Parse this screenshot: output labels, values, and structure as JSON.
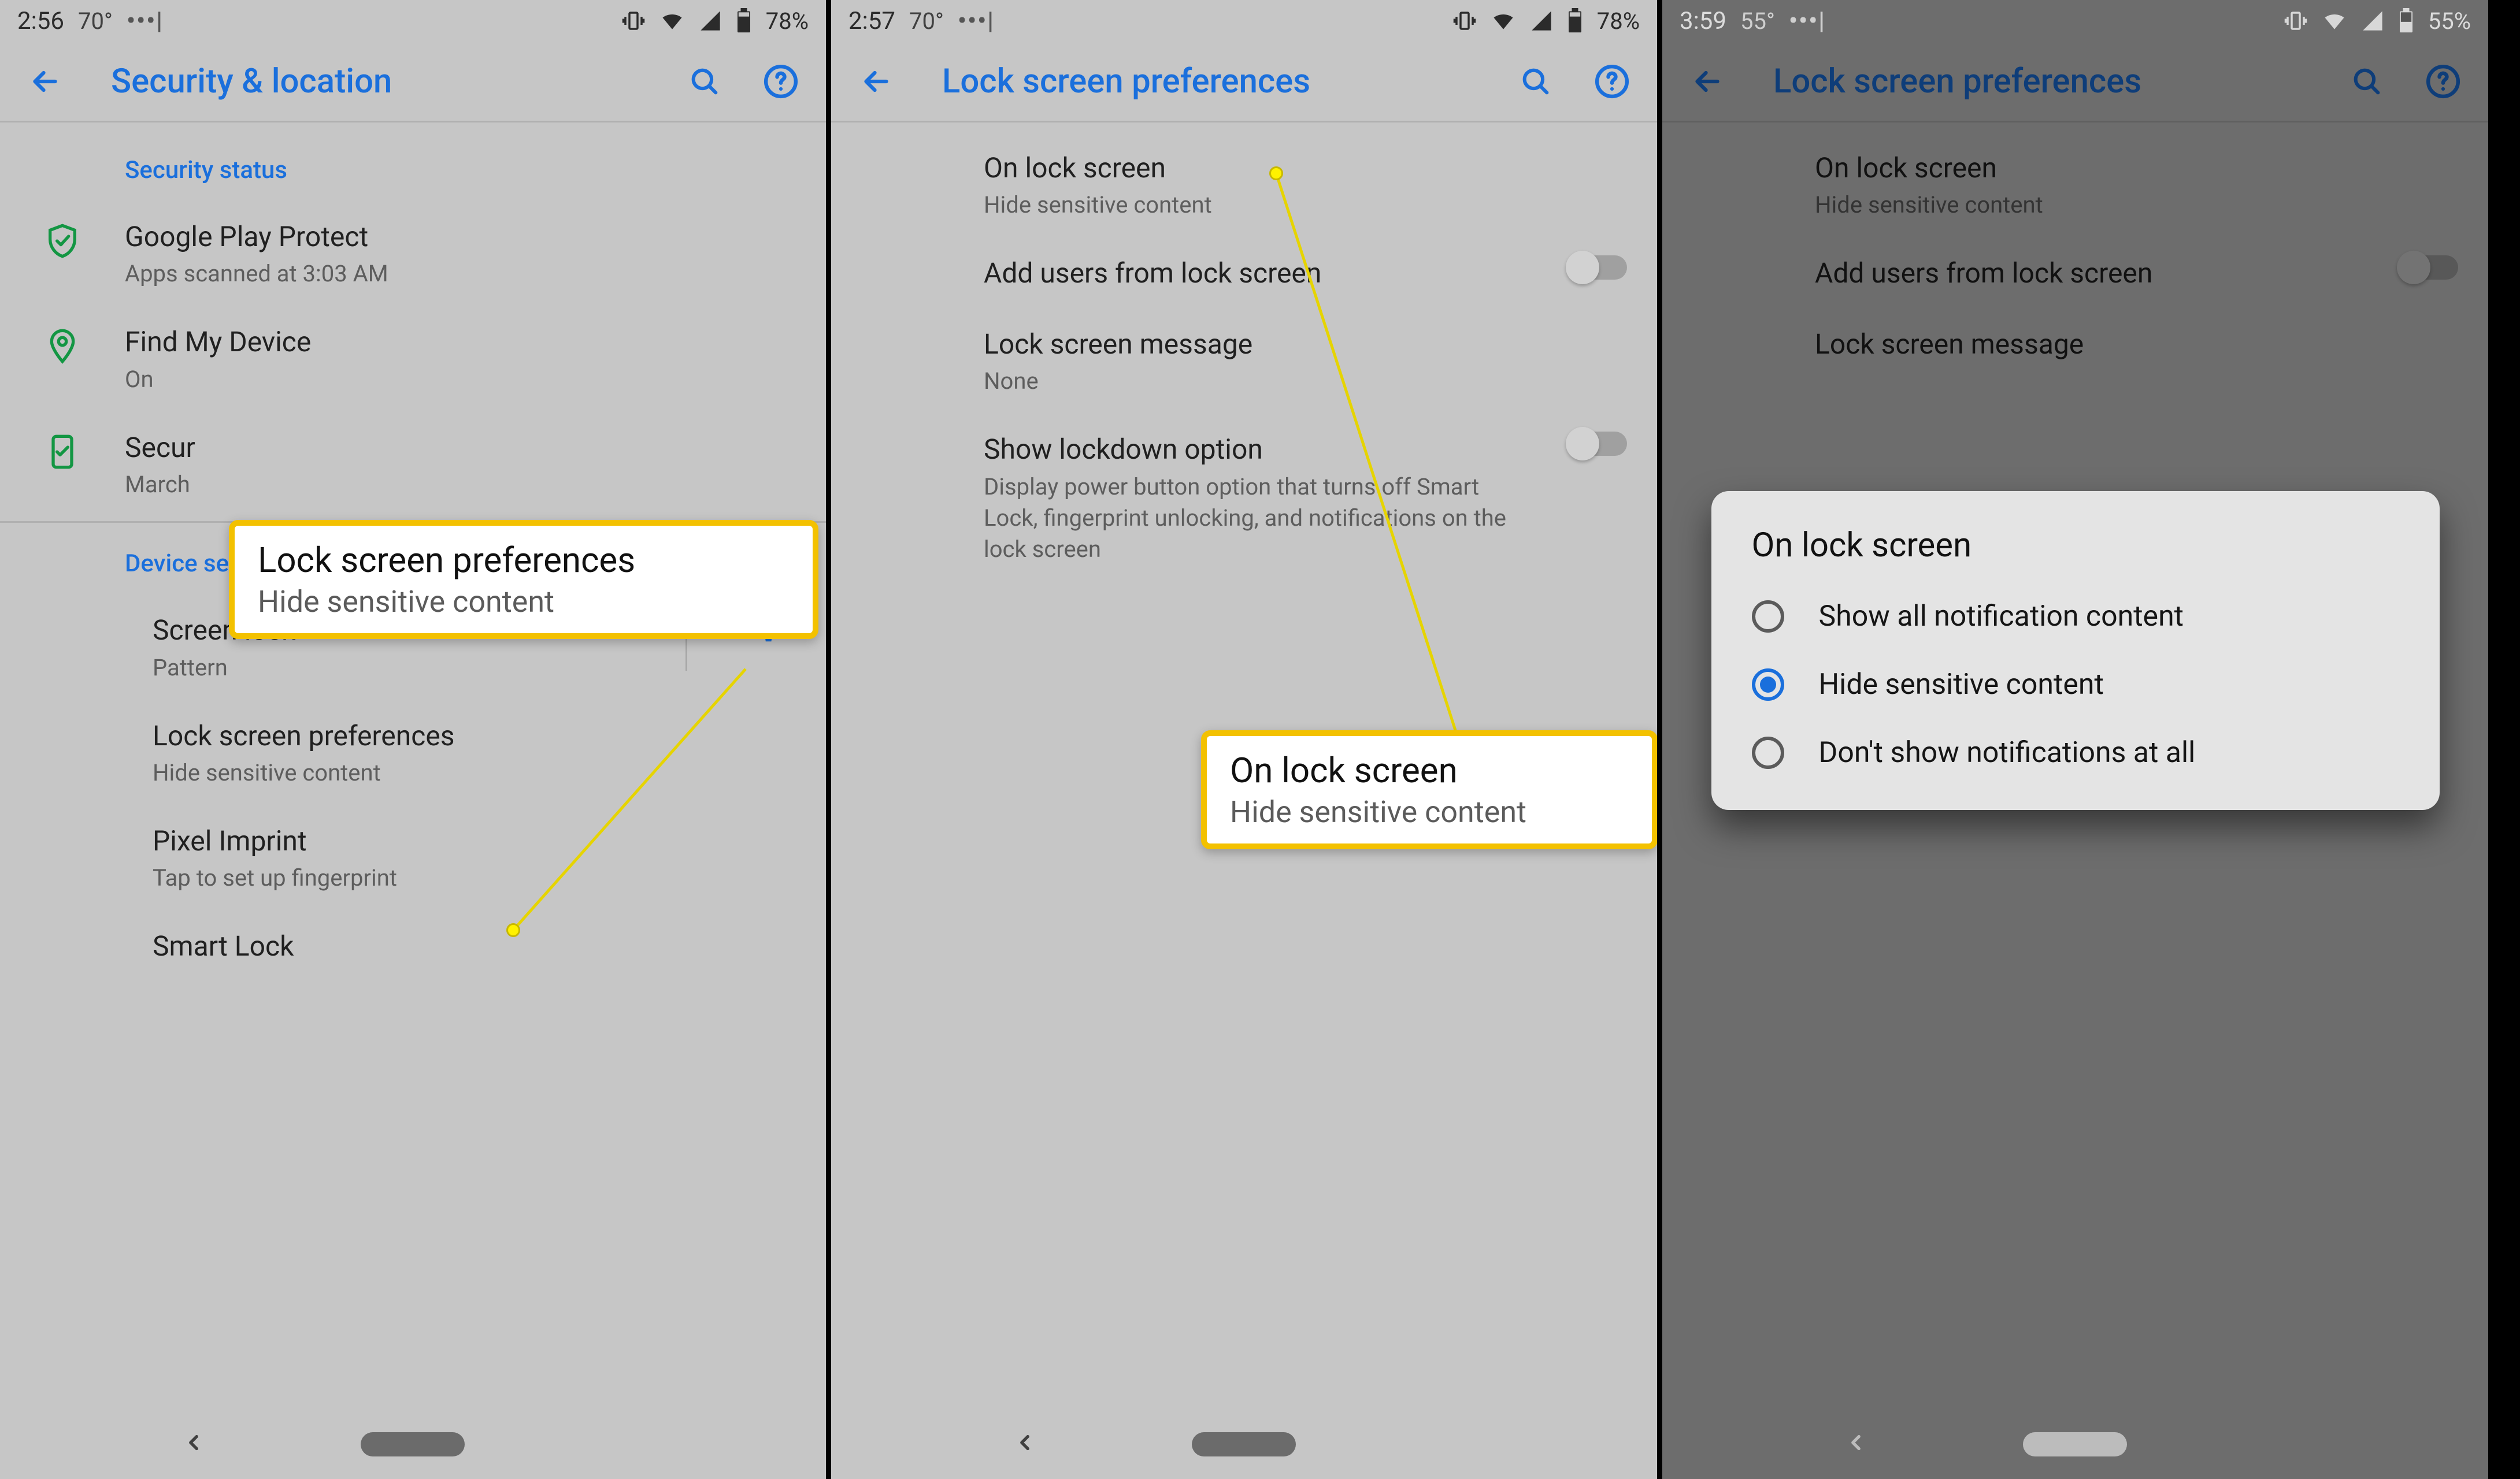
{
  "panel1": {
    "status": {
      "time": "2:56",
      "temp": "70°",
      "battery": "78%"
    },
    "appbar_title": "Security & location",
    "sections": {
      "security_status_header": "Security status",
      "device_security_header": "Device security"
    },
    "rows": {
      "gpp": {
        "primary": "Google Play Protect",
        "secondary": "Apps scanned at 3:03 AM"
      },
      "fmd": {
        "primary": "Find My Device",
        "secondary": "On"
      },
      "secup": {
        "primary": "Secur",
        "secondary": "March"
      },
      "screenlock": {
        "primary": "Screen lock",
        "secondary": "Pattern"
      },
      "lsp": {
        "primary": "Lock screen preferences",
        "secondary": "Hide sensitive content"
      },
      "pixel": {
        "primary": "Pixel Imprint",
        "secondary": "Tap to set up fingerprint"
      },
      "smart": {
        "primary": "Smart Lock"
      }
    },
    "callout": {
      "primary": "Lock screen preferences",
      "secondary": "Hide sensitive content"
    }
  },
  "panel2": {
    "status": {
      "time": "2:57",
      "temp": "70°",
      "battery": "78%"
    },
    "appbar_title": "Lock screen preferences",
    "rows": {
      "ols": {
        "primary": "On lock screen",
        "secondary": "Hide sensitive content"
      },
      "adduser": {
        "primary": "Add users from lock screen"
      },
      "msg": {
        "primary": "Lock screen message",
        "secondary": "None"
      },
      "lockdown": {
        "primary": "Show lockdown option",
        "secondary": "Display power button option that turns off Smart Lock, fingerprint unlocking, and notifications on the lock screen"
      }
    },
    "callout": {
      "primary": "On lock screen",
      "secondary": "Hide sensitive content"
    }
  },
  "panel3": {
    "status": {
      "time": "3:59",
      "temp": "55°",
      "battery": "55%"
    },
    "appbar_title": "Lock screen preferences",
    "rows": {
      "ols": {
        "primary": "On lock screen",
        "secondary": "Hide sensitive content"
      },
      "adduser": {
        "primary": "Add users from lock screen"
      },
      "msg": {
        "primary": "Lock screen message"
      }
    },
    "dialog": {
      "title": "On lock screen",
      "options": [
        {
          "label": "Show all notification content",
          "checked": false
        },
        {
          "label": "Hide sensitive content",
          "checked": true
        },
        {
          "label": "Don't show notifications at all",
          "checked": false
        }
      ]
    }
  }
}
